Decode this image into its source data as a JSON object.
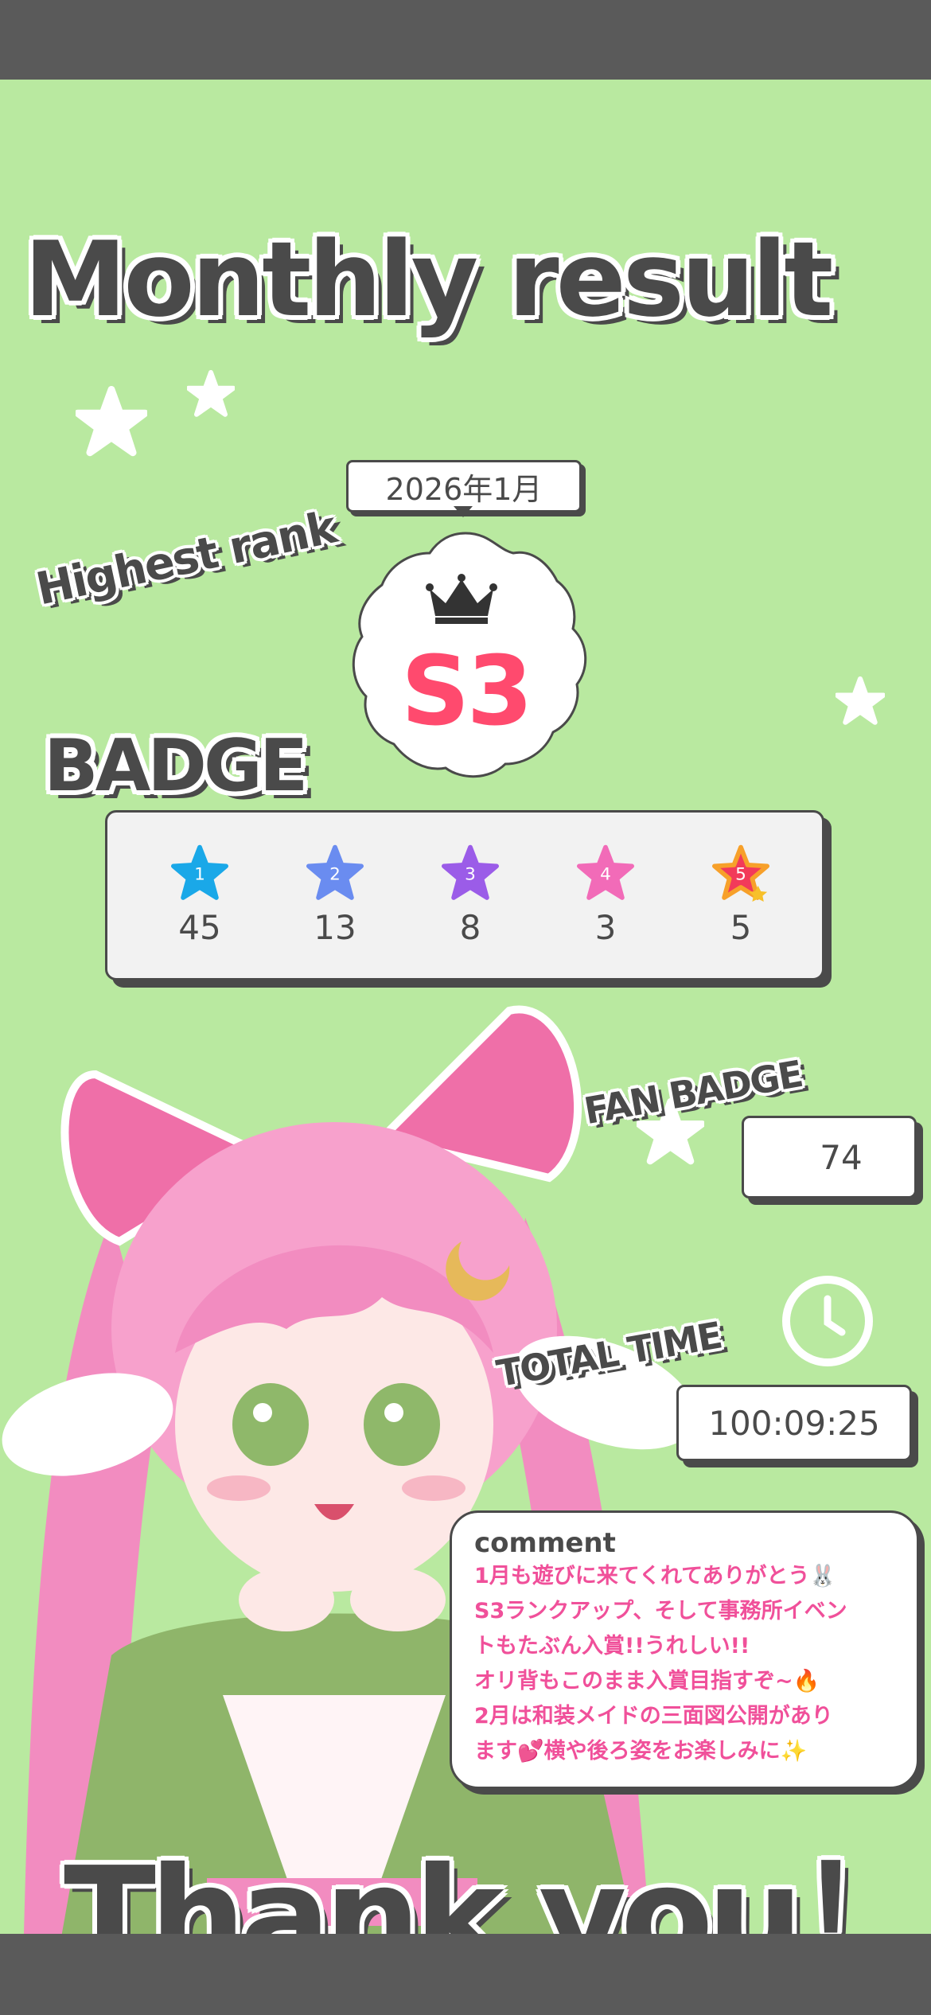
{
  "title": "Monthly result",
  "date": "2026年1月",
  "highest_rank_label": "Highest rank",
  "highest_rank_value": "S3",
  "badge_title": "BADGE",
  "badges": [
    {
      "level": "1",
      "count": "45",
      "color": "#1aa8e8"
    },
    {
      "level": "2",
      "count": "13",
      "color": "#6a8cf0"
    },
    {
      "level": "3",
      "count": "8",
      "color": "#9b5ce8"
    },
    {
      "level": "4",
      "count": "3",
      "color": "#f26bb8"
    },
    {
      "level": "5",
      "count": "5",
      "color": "#f23a5a"
    }
  ],
  "fan_badge_label": "FAN BADGE",
  "fan_badge_value": "74",
  "total_time_label": "TOTAL TIME",
  "total_time_value": "100:09:25",
  "comment": {
    "heading": "comment",
    "lines": [
      "1月も遊びに来てくれてありがとう🐰",
      "S3ランクアップ、そして事務所イベン",
      "トもたぶん入賞!!うれしい!!",
      "オリ背もこのまま入賞目指すぞ~🔥",
      "2月は和装メイドの三面図公開があり",
      "ます💕横や後ろ姿をお楽しみに✨"
    ]
  },
  "thanks": "Thank you！",
  "colors": {
    "background": "#b9e9a0",
    "ink": "#4a4a4a",
    "accent": "#f0509a"
  }
}
